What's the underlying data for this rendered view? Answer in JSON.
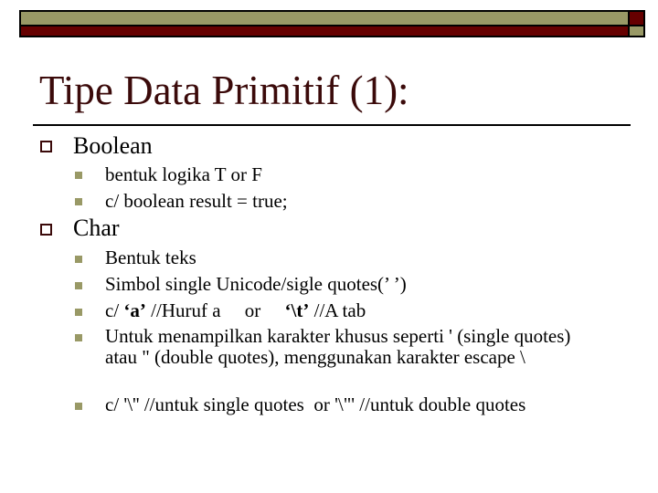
{
  "theme": {
    "title_color": "#3b0a0a",
    "header_khaki": "#999966",
    "header_red": "#660000",
    "l1_bullet_color": "#3b0a0a",
    "l2_bullet_color": "#999966"
  },
  "title": "Tipe Data Primitif (1):",
  "sections": [
    {
      "label": "Boolean",
      "items": [
        {
          "text": "bentuk logika T or F"
        },
        {
          "text": "c/ boolean result = true;"
        }
      ]
    },
    {
      "label": "Char",
      "items": [
        {
          "text": "Bentuk teks"
        },
        {
          "text": "Simbol single Unicode/sigle quotes(’ ’)"
        },
        {
          "pre": "c/ ",
          "bold1": "‘a’",
          "mid": " //Huruf a     or     ",
          "bold2": "‘\\t’",
          "post": " //A tab"
        },
        {
          "text": "Untuk menampilkan karakter khusus seperti ' (single quotes) atau \" (double quotes), menggunakan karakter escape \\"
        },
        {
          "text": "c/ '\\'' //untuk single quotes  or '\\\"' //untuk double quotes"
        }
      ]
    }
  ]
}
